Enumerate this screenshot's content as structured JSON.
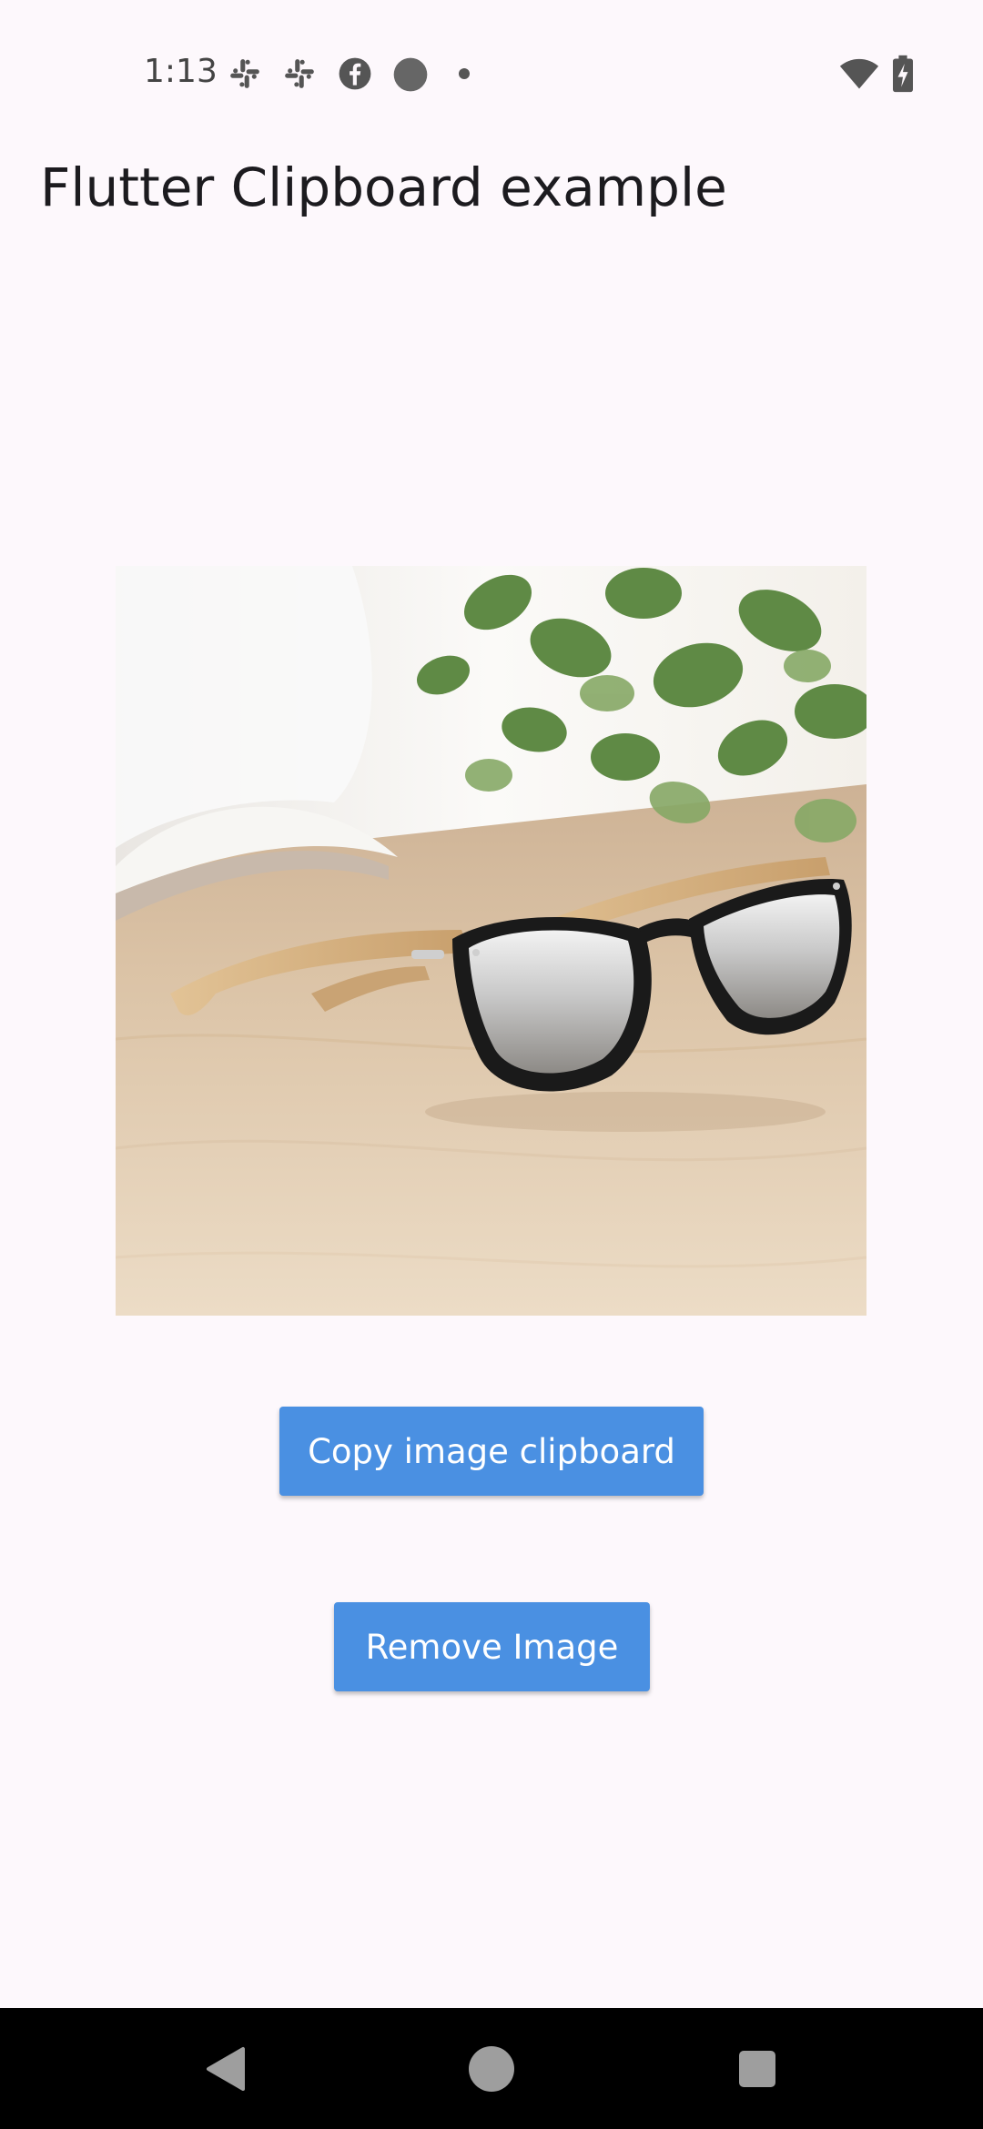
{
  "status_bar": {
    "time": "1:13",
    "icons": [
      "slack-icon",
      "slack-icon",
      "facebook-icon",
      "circle-notification-icon",
      "dot-icon",
      "wifi-icon",
      "battery-charging-icon"
    ]
  },
  "app_bar": {
    "title": "Flutter Clipboard example"
  },
  "image": {
    "subject": "sunglasses-with-wooden-temples"
  },
  "actions": {
    "copy_label": "Copy image clipboard",
    "remove_label": "Remove Image"
  },
  "colors": {
    "background": "#fdf8fc",
    "button": "#4a90e2",
    "button_text": "#ffffff",
    "nav_bar": "#000000"
  },
  "nav_bar": {
    "back": "back-icon",
    "home": "home-icon",
    "recents": "recents-icon"
  }
}
